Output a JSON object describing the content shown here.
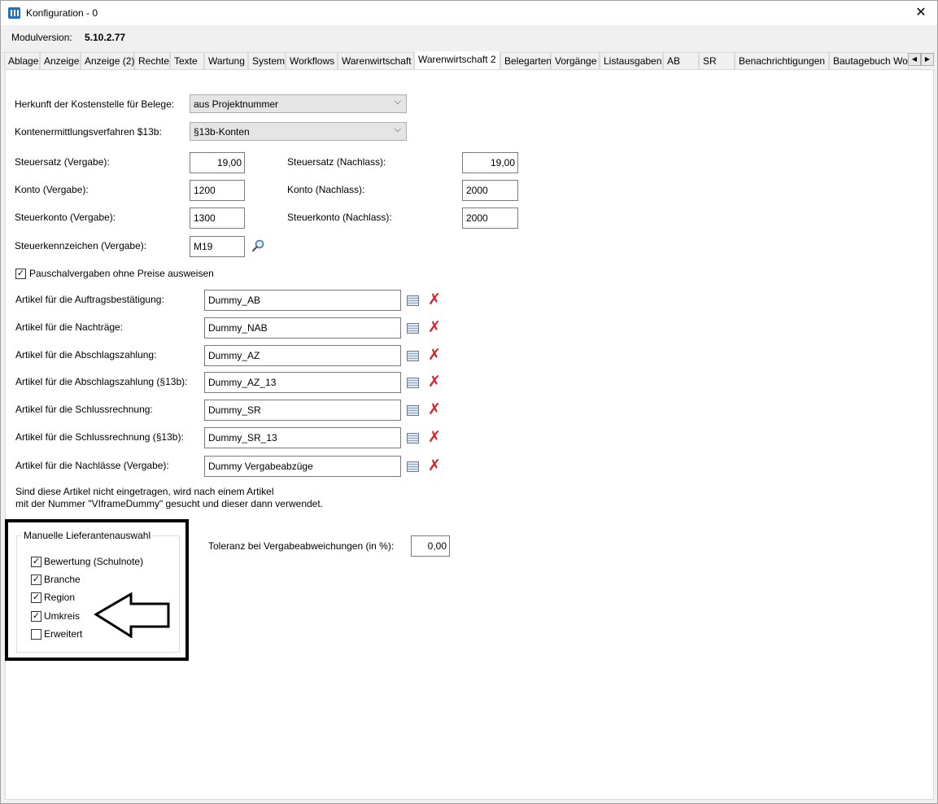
{
  "window": {
    "title": "Konfiguration - 0",
    "close_glyph": "✕"
  },
  "module": {
    "label": "Modulversion:",
    "value": "5.10.2.77"
  },
  "tabs": [
    "Ablage",
    "Anzeige",
    "Anzeige (2)",
    "Rechte",
    "Texte",
    "Wartung",
    "System",
    "Workflows",
    "Warenwirtschaft",
    "Warenwirtschaft 2",
    "Belegarten",
    "Vorgänge",
    "Listausgaben",
    "AB",
    "SR",
    "Benachrichtigungen",
    "Bautagebuch Wo"
  ],
  "active_tab": "Warenwirtschaft 2",
  "form": {
    "kostenstelle_label": "Herkunft der Kostenstelle für Belege:",
    "kostenstelle_value": "aus Projektnummer",
    "konten_label": "Kontenermittlungsverfahren $13b:",
    "konten_value": "§13b-Konten",
    "steuersatz_vergabe_label": "Steuersatz (Vergabe):",
    "steuersatz_vergabe_value": "19,00",
    "steuersatz_nachlass_label": "Steuersatz (Nachlass):",
    "steuersatz_nachlass_value": "19,00",
    "konto_vergabe_label": "Konto (Vergabe):",
    "konto_vergabe_value": "1200",
    "konto_nachlass_label": "Konto (Nachlass):",
    "konto_nachlass_value": "2000",
    "steuerkonto_vergabe_label": "Steuerkonto (Vergabe):",
    "steuerkonto_vergabe_value": "1300",
    "steuerkonto_nachlass_label": "Steuerkonto (Nachlass):",
    "steuerkonto_nachlass_value": "2000",
    "steuerkennzeichen_label": "Steuerkennzeichen (Vergabe):",
    "steuerkennzeichen_value": "M19",
    "pauschal_label": "Pauschalvergaben ohne Preise ausweisen",
    "pauschal_checked": true
  },
  "articles": [
    {
      "label": "Artikel für die Auftragsbestätigung:",
      "value": "Dummy_AB"
    },
    {
      "label": "Artikel für die Nachträge:",
      "value": "Dummy_NAB"
    },
    {
      "label": "Artikel für die Abschlagszahlung:",
      "value": "Dummy_AZ"
    },
    {
      "label": "Artikel für die Abschlagszahlung (§13b):",
      "value": "Dummy_AZ_13"
    },
    {
      "label": "Artikel für die Schlussrechnung:",
      "value": "Dummy_SR"
    },
    {
      "label": "Artikel für die Schlussrechnung (§13b):",
      "value": "Dummy_SR_13"
    },
    {
      "label": "Artikel für die Nachlässe (Vergabe):",
      "value": "Dummy Vergabeabzüge"
    }
  ],
  "note": {
    "line1": "Sind diese Artikel nicht eingetragen, wird nach einem Artikel",
    "line2": "mit der Nummer \"VIframeDummy\" gesucht und dieser dann verwendet."
  },
  "supplier_group": {
    "title": "Manuelle Lieferantenauswahl",
    "items": [
      {
        "label": "Bewertung (Schulnote)",
        "checked": true
      },
      {
        "label": "Branche",
        "checked": true
      },
      {
        "label": "Region",
        "checked": true
      },
      {
        "label": "Umkreis",
        "checked": true
      },
      {
        "label": "Erweitert",
        "checked": false
      }
    ]
  },
  "toleranz": {
    "label": "Toleranz bei Vergabeabweichungen (in %):",
    "value": "0,00"
  },
  "icons": {
    "check": "✓",
    "delete": "✗",
    "chevron": "⌵",
    "arrow_left": "◀",
    "arrow_right": "▶"
  }
}
